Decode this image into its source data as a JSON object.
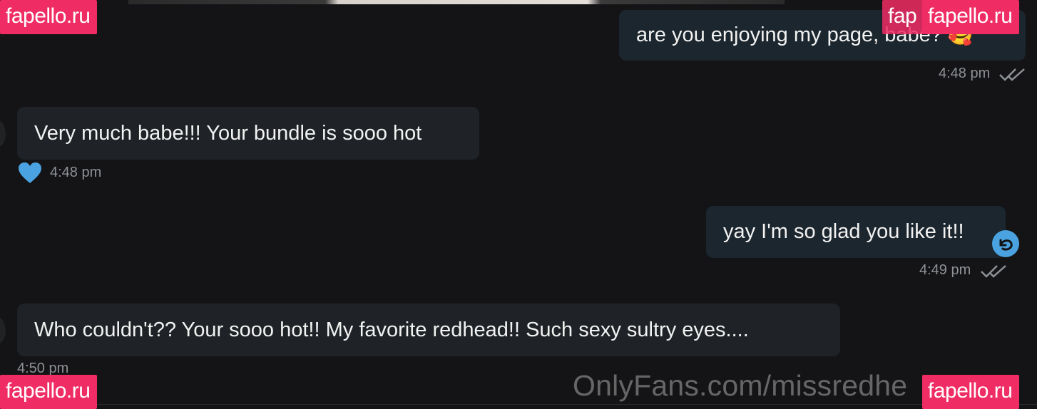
{
  "messages": [
    {
      "direction": "outgoing",
      "text": "are you enjoying my page, babe? 🥰",
      "time": "4:48 pm"
    },
    {
      "direction": "incoming",
      "text": "Very much babe!!! Your bundle is sooo hot",
      "time": "4:48 pm",
      "reaction": "heart-icon"
    },
    {
      "direction": "outgoing",
      "text": "yay I'm so glad you like it!!",
      "time": "4:49 pm"
    },
    {
      "direction": "incoming",
      "text": "Who couldn't?? Your sooo hot!! My favorite redhead!! Such sexy sultry eyes....",
      "time": "4:50 pm"
    }
  ],
  "watermarks": {
    "top_left": "fapello.ru",
    "top_right": "fapello.ru",
    "top_right_ghost": "fap",
    "bottom_left": "fapello.ru",
    "bottom_right": "fapello.ru"
  },
  "overlay_text": "OnlyFans.com/missredhe",
  "colors": {
    "background": "#141416",
    "bubble_incoming": "#1f2327",
    "bubble_outgoing": "#1c262e",
    "accent_blue": "#4aa3e0",
    "watermark_pink": "#ef2c63",
    "timestamp": "#8d9196"
  }
}
